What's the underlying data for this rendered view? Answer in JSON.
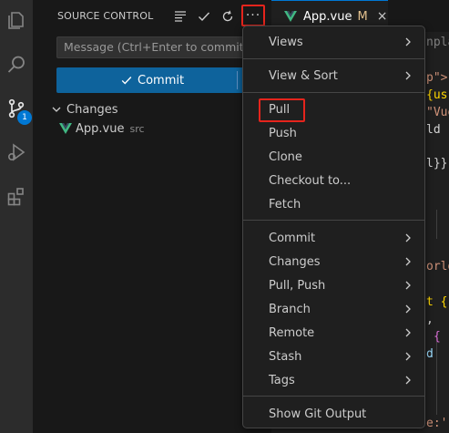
{
  "activity_bar": {
    "items": [
      {
        "icon": "explorer-icon"
      },
      {
        "icon": "search-icon"
      },
      {
        "icon": "source-control-icon",
        "badge": "1"
      },
      {
        "icon": "run-debug-icon"
      },
      {
        "icon": "extensions-icon"
      }
    ]
  },
  "source_control": {
    "title": "SOURCE CONTROL",
    "toolbar": [
      "view-tree-icon",
      "commit-check-icon",
      "refresh-icon"
    ],
    "more_label": "···",
    "message_placeholder": "Message (Ctrl+Enter to commit on",
    "commit_label": "Commit",
    "changes_label": "Changes",
    "file": {
      "name": "App.vue",
      "path": "src"
    }
  },
  "editor": {
    "tab": {
      "label": "App.vue",
      "status": "M",
      "close": "×"
    },
    "code_fragments": [
      "nplat",
      "p\">",
      "{us",
      "\"Vue",
      "ld r",
      "l}}",
      "orld",
      "t {",
      ",",
      "{",
      "d",
      "e:'"
    ]
  },
  "menu": {
    "items": [
      {
        "label": "Views",
        "submenu": true
      },
      {
        "label": "View & Sort",
        "submenu": true
      },
      {
        "label": "Pull",
        "submenu": false,
        "highlighted": true
      },
      {
        "label": "Push",
        "submenu": false
      },
      {
        "label": "Clone",
        "submenu": false
      },
      {
        "label": "Checkout to...",
        "submenu": false
      },
      {
        "label": "Fetch",
        "submenu": false
      },
      {
        "label": "Commit",
        "submenu": true
      },
      {
        "label": "Changes",
        "submenu": true
      },
      {
        "label": "Pull, Push",
        "submenu": true
      },
      {
        "label": "Branch",
        "submenu": true
      },
      {
        "label": "Remote",
        "submenu": true
      },
      {
        "label": "Stash",
        "submenu": true
      },
      {
        "label": "Tags",
        "submenu": true
      },
      {
        "label": "Show Git Output",
        "submenu": false
      }
    ]
  },
  "colors": {
    "accent": "#0e639c",
    "highlight_box": "#e5241c",
    "vue_green": "#41b883",
    "modified": "#e2c08d"
  }
}
